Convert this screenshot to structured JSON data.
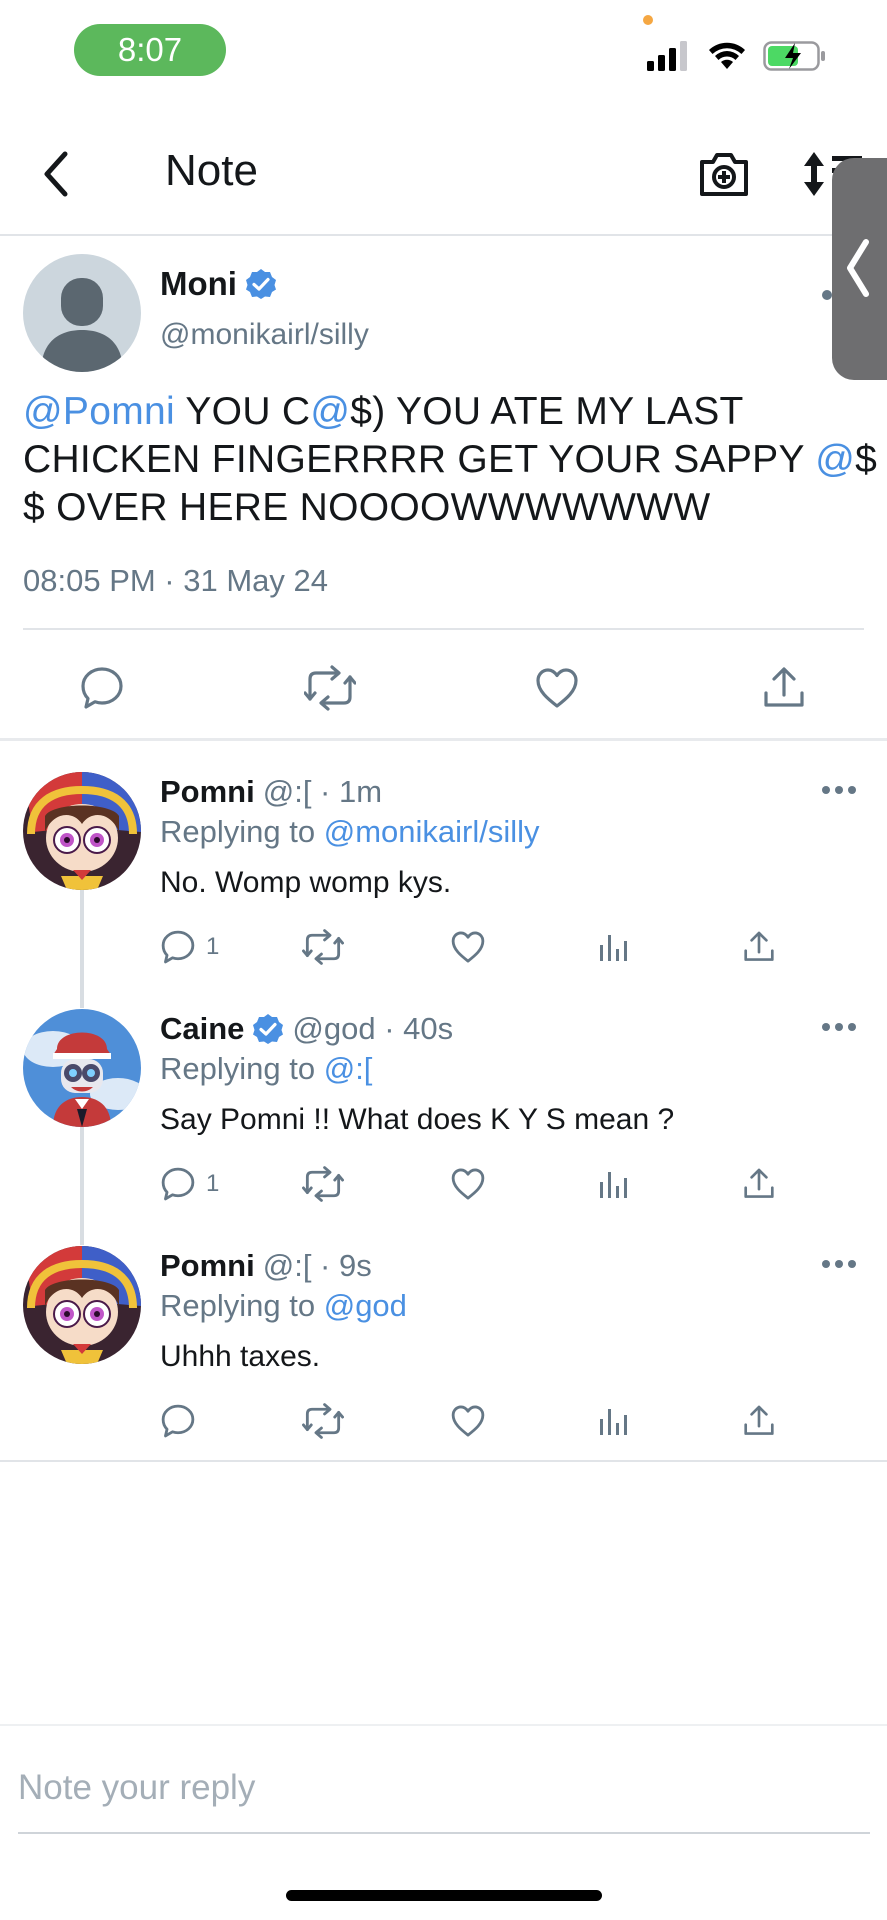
{
  "status_bar": {
    "time": "8:07",
    "icons": [
      "signal-icon",
      "wifi-icon",
      "battery-charging-icon"
    ],
    "pill_color": "#5cb85c"
  },
  "nav": {
    "title": "Note",
    "back_icon": "chevron-left-icon",
    "camera_icon": "camera-plus-icon",
    "sort_icon": "sort-icon"
  },
  "main_tweet": {
    "name": "Moni",
    "verified": true,
    "handle": "@monikairl/silly",
    "text_parts": {
      "mention1": "@Pomni",
      "seg1": " YOU C",
      "at1": "@",
      "seg2": "$) YOU ATE MY LAST CHICKEN FINGERRRR GET YOUR SAPPY ",
      "at2": "@",
      "seg3": "$ $ OVER HERE NOOOOWWWWWWW"
    },
    "timestamp": "08:05 PM · 31 May 24"
  },
  "replies": [
    {
      "name": "Pomni",
      "verified": false,
      "meta": "@:[ · 1m",
      "replying_label": "Replying to",
      "replying_to": "@monikairl/silly",
      "text": "No. Womp womp kys.",
      "reply_count": "1"
    },
    {
      "name": "Caine",
      "verified": true,
      "meta": "@god · 40s",
      "replying_label": "Replying to",
      "replying_to": "@:[",
      "text": "Say Pomni !! What does K Y S mean ?",
      "reply_count": "1"
    },
    {
      "name": "Pomni",
      "verified": false,
      "meta": "@:[ · 9s",
      "replying_label": "Replying to",
      "replying_to": "@god",
      "text": "Uhhh taxes.",
      "reply_count": ""
    }
  ],
  "composer": {
    "placeholder": "Note your reply"
  },
  "colors": {
    "accent": "#4a90e2",
    "secondary_text": "#657786",
    "verified": "#4a90e2"
  }
}
